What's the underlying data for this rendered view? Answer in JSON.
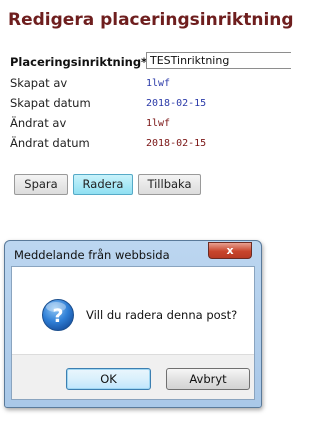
{
  "page": {
    "title": "Redigera placeringsinriktning"
  },
  "form": {
    "name_label": "Placeringsinriktning*",
    "name_value": "TESTinriktning",
    "created_by_label": "Skapat av",
    "created_by_value": "1lwf",
    "created_date_label": "Skapat datum",
    "created_date_value": "2018-02-15",
    "changed_by_label": "Ändrat av",
    "changed_by_value": "1lwf",
    "changed_date_label": "Ändrat datum",
    "changed_date_value": "2018-02-15"
  },
  "buttons": {
    "save": "Spara",
    "delete": "Radera",
    "back": "Tillbaka"
  },
  "dialog": {
    "title": "Meddelande från webbsida",
    "close_glyph": "x",
    "message": "Vill du radera denna post?",
    "ok": "OK",
    "cancel": "Avbryt",
    "icon": "question-icon"
  },
  "colors": {
    "title": "#6e1e1e",
    "created_value": "#2b3aa8",
    "changed_value": "#7a1414",
    "active_button": "#8fe0f2"
  }
}
